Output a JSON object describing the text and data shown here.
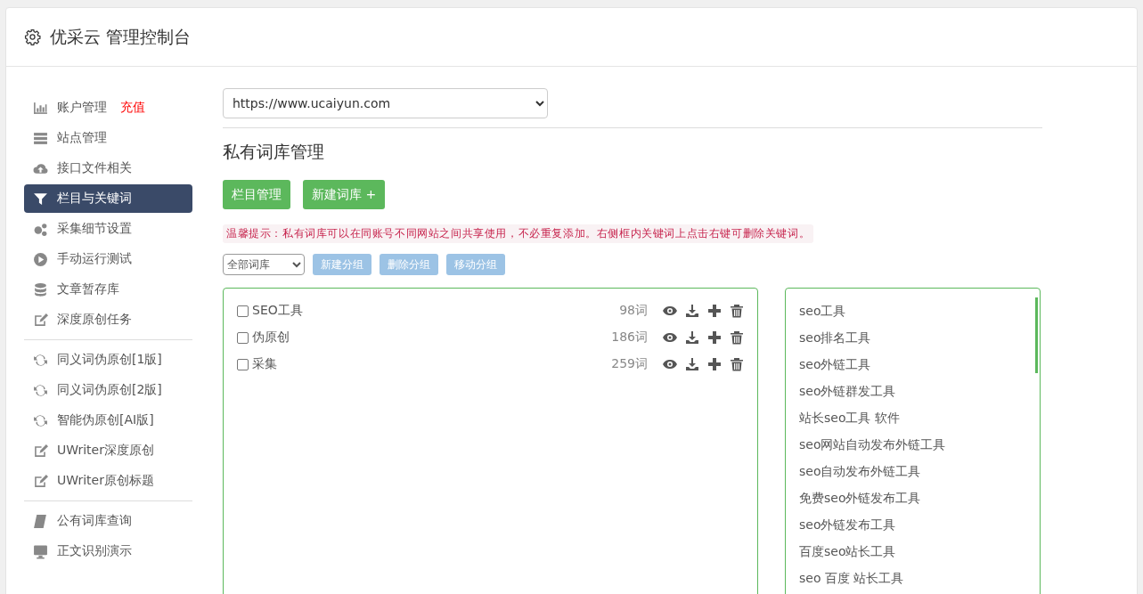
{
  "header": {
    "title": "优采云 管理控制台"
  },
  "sidebar": {
    "groups": [
      {
        "items": [
          {
            "label": "账户管理",
            "badge": "充值",
            "selected": false
          },
          {
            "label": "站点管理",
            "selected": false
          },
          {
            "label": "接口文件相关",
            "selected": false
          },
          {
            "label": "栏目与关键词",
            "selected": true
          },
          {
            "label": "采集细节设置",
            "selected": false
          },
          {
            "label": "手动运行测试",
            "selected": false
          },
          {
            "label": "文章暂存库",
            "selected": false
          },
          {
            "label": "深度原创任务",
            "selected": false
          }
        ]
      },
      {
        "items": [
          {
            "label": "同义词伪原创[1版]",
            "selected": false
          },
          {
            "label": "同义词伪原创[2版]",
            "selected": false
          },
          {
            "label": "智能伪原创[AI版]",
            "selected": false
          },
          {
            "label": "UWriter深度原创",
            "selected": false
          },
          {
            "label": "UWriter原创标题",
            "selected": false
          }
        ]
      },
      {
        "items": [
          {
            "label": "公有词库查询",
            "selected": false
          },
          {
            "label": "正文识别演示",
            "selected": false
          }
        ]
      }
    ]
  },
  "site_select": {
    "value": "https://www.ucaiyun.com"
  },
  "page_title": "私有词库管理",
  "actions": [
    {
      "label": "栏目管理"
    },
    {
      "label": "新建词库 +"
    }
  ],
  "tip": "温馨提示：私有词库可以在同账号不同网站之间共享使用，不必重复添加。右侧框内关键词上点击右键可删除关键词。",
  "toolbar": {
    "group_select": {
      "value": "全部词库"
    },
    "buttons": [
      {
        "label": "新建分组",
        "disabled": true
      },
      {
        "label": "删除分组",
        "disabled": true
      },
      {
        "label": "移动分组",
        "disabled": true
      }
    ]
  },
  "libraries": [
    {
      "name": "SEO工具",
      "count": "98词",
      "checked": false
    },
    {
      "name": "伪原创",
      "count": "186词",
      "checked": false
    },
    {
      "name": "采集",
      "count": "259词",
      "checked": false
    }
  ],
  "keywords": [
    "seo工具",
    "seo排名工具",
    "seo外链工具",
    "seo外链群发工具",
    "站长seo工具 软件",
    "seo网站自动发布外链工具",
    "seo自动发布外链工具",
    "免费seo外链发布工具",
    "seo外链发布工具",
    "百度seo站长工具",
    "seo 百度 站长工具"
  ]
}
